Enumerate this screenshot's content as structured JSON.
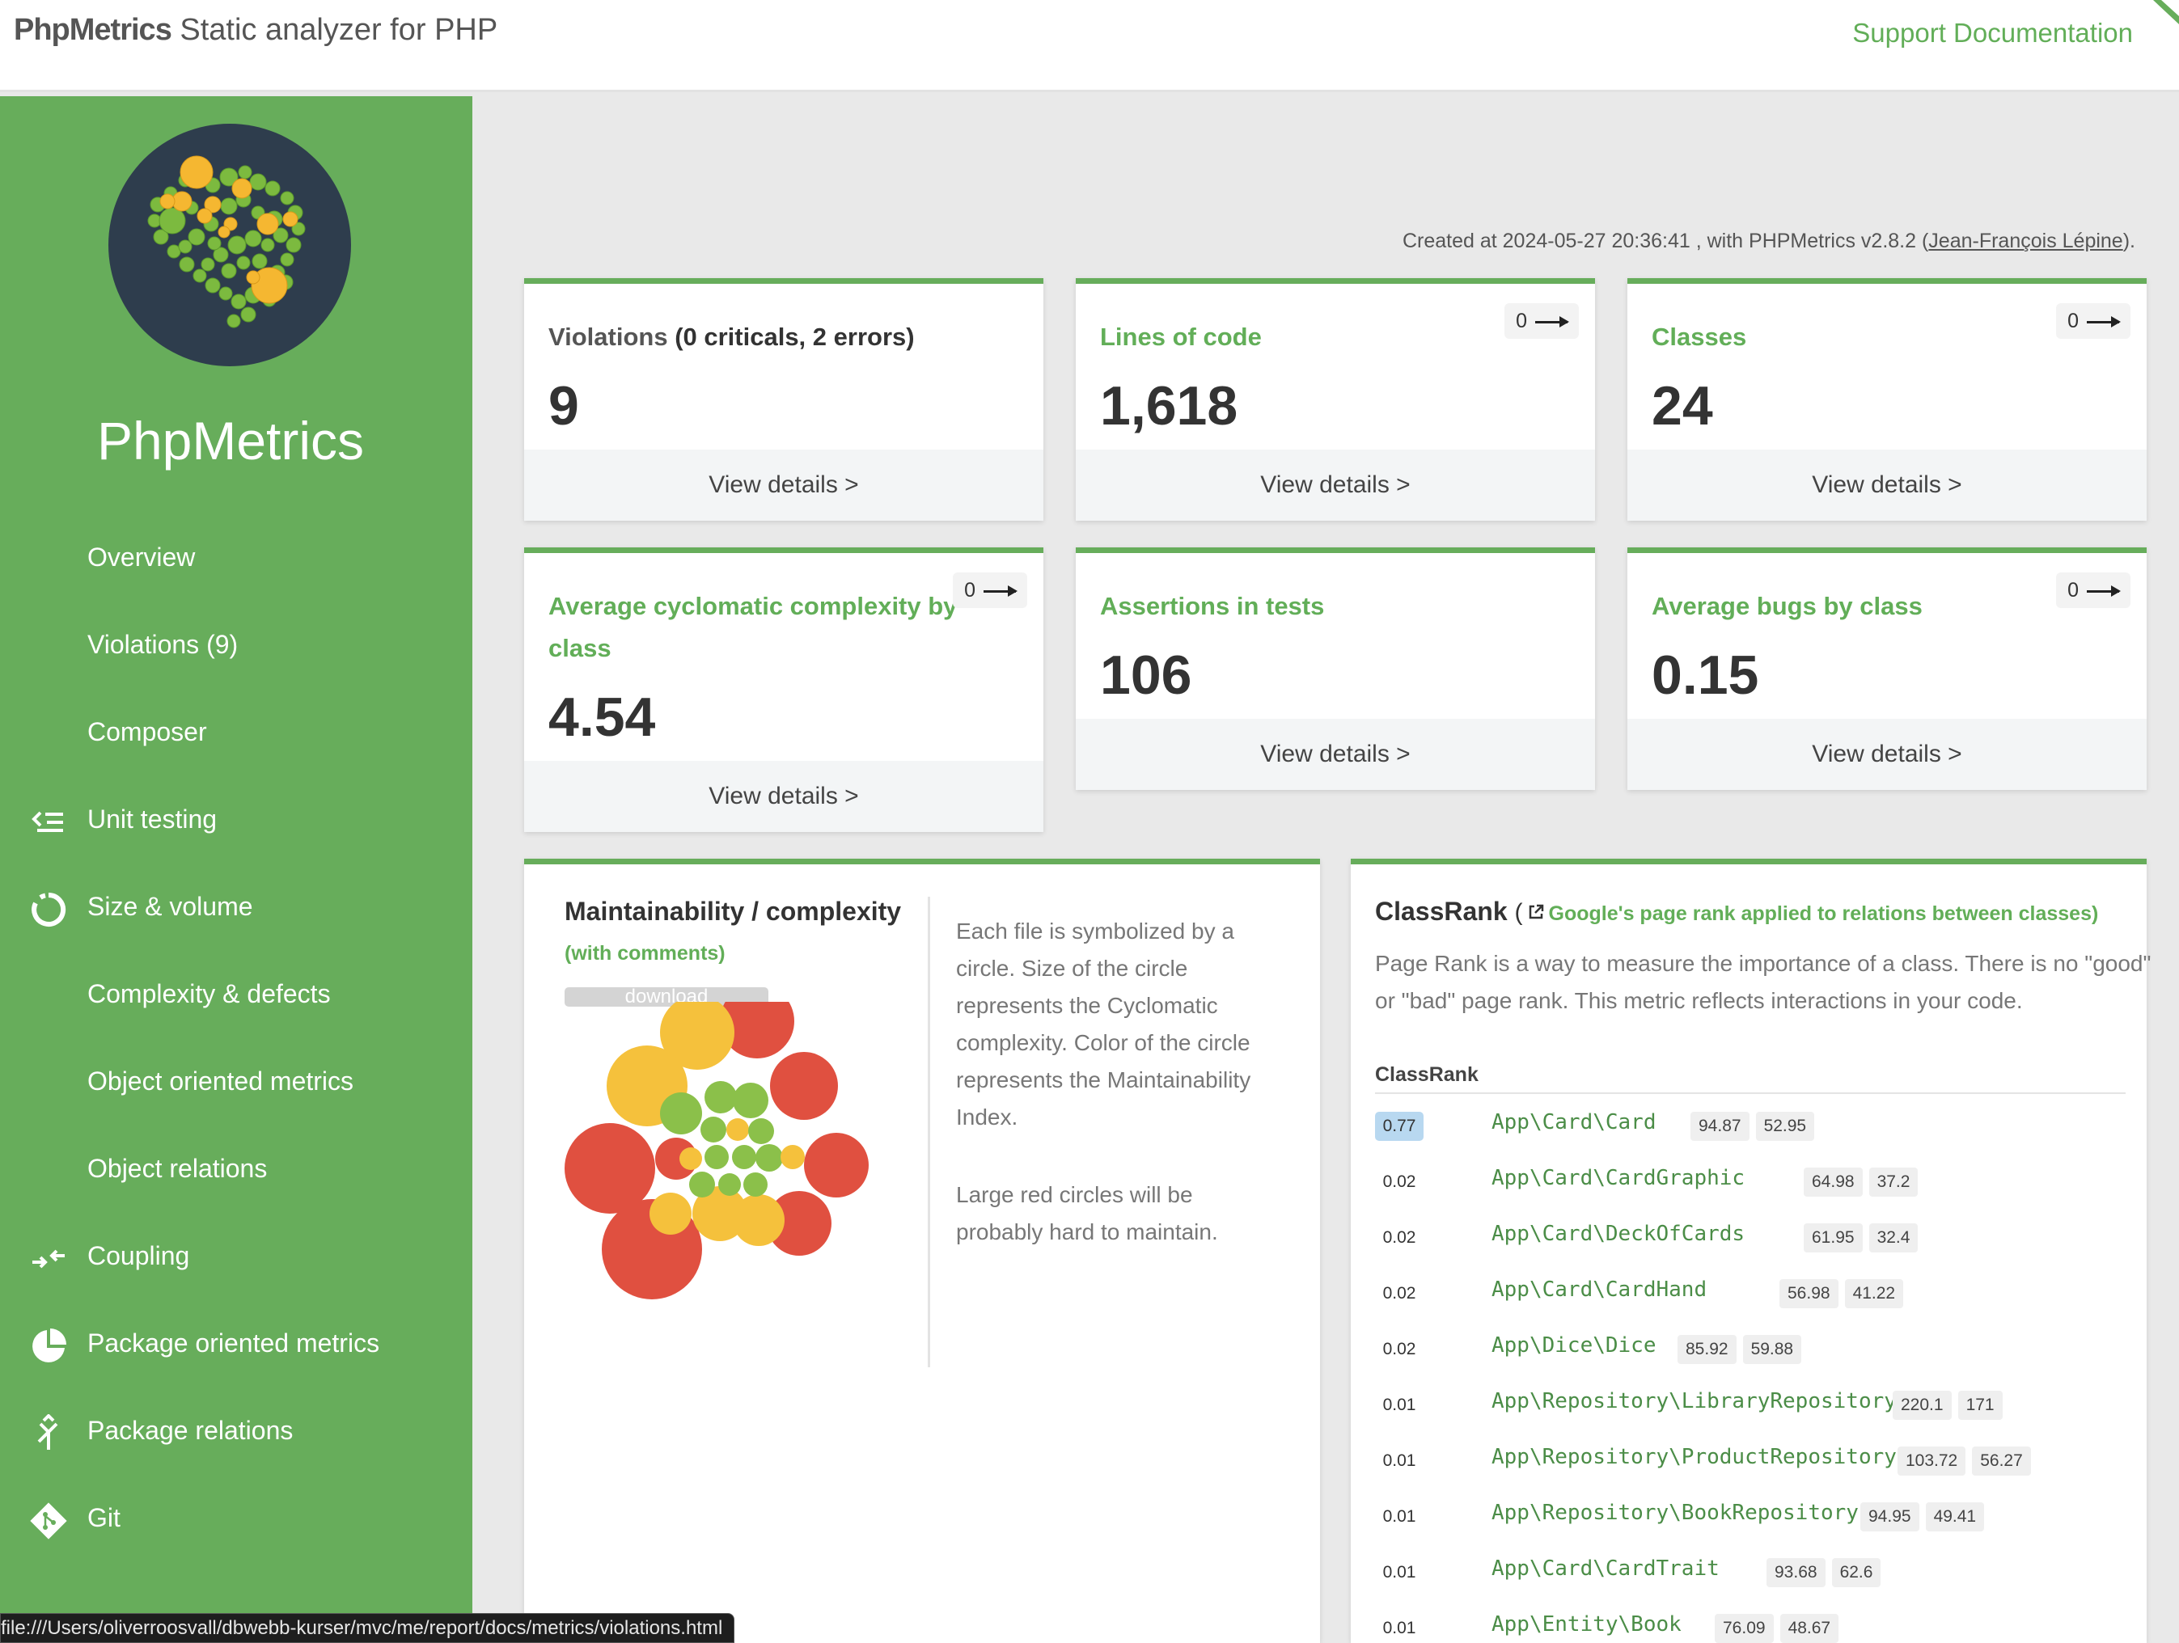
{
  "header": {
    "brand_bold": "PhpMetrics",
    "brand_rest": " Static analyzer for PHP",
    "support_link": "Support Documentation",
    "accent_color": "#67ad5b"
  },
  "sidebar": {
    "title": "PhpMetrics",
    "items": [
      {
        "label": "Overview",
        "icon": ""
      },
      {
        "label": "Violations (9)",
        "icon": ""
      },
      {
        "label": "Composer",
        "icon": ""
      },
      {
        "label": "Unit testing",
        "icon": "list-check-icon"
      },
      {
        "label": "Size & volume",
        "icon": "circle-notch-icon"
      },
      {
        "label": "Complexity & defects",
        "icon": ""
      },
      {
        "label": "Object oriented metrics",
        "icon": ""
      },
      {
        "label": "Object relations",
        "icon": ""
      },
      {
        "label": "Coupling",
        "icon": "coupling-arrows-icon"
      },
      {
        "label": "Package oriented metrics",
        "icon": "pie-chart-icon"
      },
      {
        "label": "Package relations",
        "icon": "merge-icon"
      },
      {
        "label": "Git",
        "icon": "git-icon"
      }
    ]
  },
  "created": {
    "prefix": "Created at 2024-05-27 20:36:41 , with PHPMetrics v2.8.2 (",
    "author": "Jean-François Lépine",
    "suffix": ")."
  },
  "cards": [
    {
      "title": "Violations",
      "title_extra": " (0 criticals, 2 errors)",
      "value": "9",
      "footer": "View details >",
      "badge": ""
    },
    {
      "title": "Lines of code",
      "title_extra": "",
      "value": "1,618",
      "footer": "View details >",
      "badge": "0"
    },
    {
      "title": "Classes",
      "title_extra": "",
      "value": "24",
      "footer": "View details >",
      "badge": "0"
    },
    {
      "title": "Average cyclomatic complexity by class",
      "title_extra": "",
      "value": "4.54",
      "footer": "View details >",
      "badge": "0"
    },
    {
      "title": "Assertions in tests",
      "title_extra": "",
      "value": "106",
      "footer": "View details >",
      "badge": ""
    },
    {
      "title": "Average bugs by class",
      "title_extra": "",
      "value": "0.15",
      "footer": "View details >",
      "badge": "0"
    }
  ],
  "maintainability": {
    "title": "Maintainability / complexity",
    "subtitle": "(with comments)",
    "download": "download",
    "desc1": "Each file is symbolized by a circle. Size of the circle represents the Cyclomatic complexity. Color of the circle represents the Maintainability Index.",
    "desc2": "Large red circles will be probably hard to maintain.",
    "colors": {
      "red": "#e05040",
      "yellow": "#f5c13c",
      "green": "#8bc04a"
    }
  },
  "classrank": {
    "title": "ClassRank",
    "link": "Google's page rank applied to relations between classes)",
    "desc": "Page Rank is a way to measure the importance of a class. There is no \"good\" or \"bad\" page rank. This metric reflects interactions in your code.",
    "column": "ClassRank",
    "rows": [
      {
        "score": "0.77",
        "name": "App\\Card\\Card",
        "a": "94.87",
        "b": "52.95"
      },
      {
        "score": "0.02",
        "name": "App\\Card\\CardGraphic",
        "a": "64.98",
        "b": "37.2"
      },
      {
        "score": "0.02",
        "name": "App\\Card\\DeckOfCards",
        "a": "61.95",
        "b": "32.4"
      },
      {
        "score": "0.02",
        "name": "App\\Card\\CardHand",
        "a": "56.98",
        "b": "41.22"
      },
      {
        "score": "0.02",
        "name": "App\\Dice\\Dice",
        "a": "85.92",
        "b": "59.88"
      },
      {
        "score": "0.01",
        "name": "App\\Repository\\LibraryRepository",
        "a": "220.1",
        "b": "171"
      },
      {
        "score": "0.01",
        "name": "App\\Repository\\ProductRepository",
        "a": "103.72",
        "b": "56.27"
      },
      {
        "score": "0.01",
        "name": "App\\Repository\\BookRepository",
        "a": "94.95",
        "b": "49.41"
      },
      {
        "score": "0.01",
        "name": "App\\Card\\CardTrait",
        "a": "93.68",
        "b": "62.6"
      },
      {
        "score": "0.01",
        "name": "App\\Entity\\Book",
        "a": "76.09",
        "b": "48.67"
      }
    ]
  },
  "statusbar": {
    "url": "file:///Users/oliverroosvall/dbwebb-kurser/mvc/me/report/docs/metrics/violations.html"
  }
}
